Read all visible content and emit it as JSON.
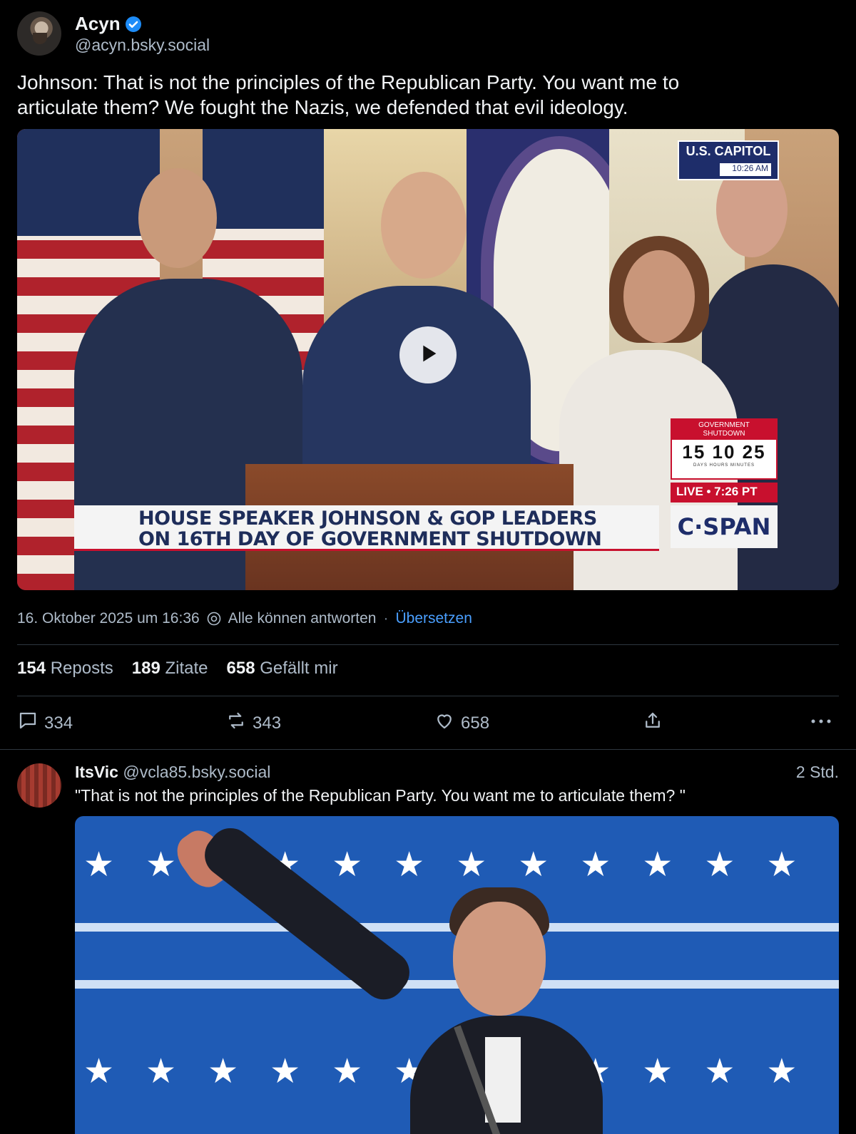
{
  "post": {
    "author_name": "Acyn",
    "author_handle": "@acyn.bsky.social",
    "text_line1": "Johnson: That is not the principles of the Republican Party. You want me to",
    "text_line2": "articulate them? We fought the Nazis, we defended that evil ideology.",
    "video": {
      "lower_third_line1": "HOUSE SPEAKER JOHNSON & GOP LEADERS",
      "lower_third_line2": "ON 16TH DAY OF GOVERNMENT SHUTDOWN",
      "capitol_label": "U.S. CAPITOL",
      "capitol_time": "10:26 AM",
      "shutdown_label_1": "GOVERNMENT",
      "shutdown_label_2": "SHUTDOWN",
      "shutdown_digits": "15 10 25",
      "shutdown_units": "DAYS  HOURS  MINUTES",
      "live_label": "LIVE • 7:26 PT",
      "network": "C·SPAN"
    },
    "timestamp": "16. Oktober 2025 um 16:36",
    "reply_setting": "Alle können antworten",
    "separator": "·",
    "translate_link": "Übersetzen",
    "stats": {
      "reposts_count": "154",
      "reposts_label": "Reposts",
      "quotes_count": "189",
      "quotes_label": "Zitate",
      "likes_count": "658",
      "likes_label": "Gefällt mir"
    },
    "actions": {
      "replies": "334",
      "reposts": "343",
      "likes": "658"
    }
  },
  "reply": {
    "author_name": "ItsVic",
    "author_handle": "@vcla85.bsky.social",
    "time": "2 Std.",
    "text": "\"That is not the principles of the Republican Party. You want me to articulate them? \""
  },
  "colors": {
    "background": "#000000",
    "text_primary": "#f1f3f5",
    "text_secondary": "#aebbc9",
    "link": "#4a9fff",
    "verified": "#1d8cf8"
  }
}
